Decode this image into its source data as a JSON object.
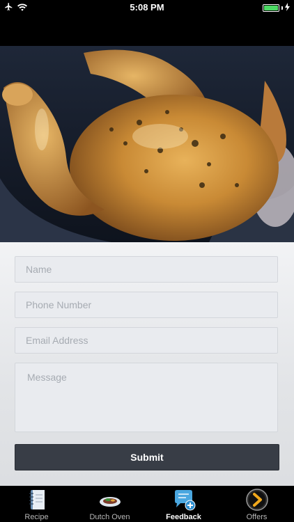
{
  "status_bar": {
    "time": "5:08 PM",
    "battery_level": 1.0
  },
  "form": {
    "name_placeholder": "Name",
    "phone_placeholder": "Phone Number",
    "email_placeholder": "Email Address",
    "message_placeholder": "Message",
    "submit_label": "Submit"
  },
  "tabs": [
    {
      "label": "Recipe",
      "icon": "notebook-icon",
      "active": false
    },
    {
      "label": "Dutch Oven",
      "icon": "dish-icon",
      "active": false
    },
    {
      "label": "Feedback",
      "icon": "chat-add-icon",
      "active": true
    },
    {
      "label": "Offers",
      "icon": "chevron-right-circle-icon",
      "active": false
    }
  ],
  "colors": {
    "submit_bg": "#383d46",
    "battery": "#4cd964"
  }
}
